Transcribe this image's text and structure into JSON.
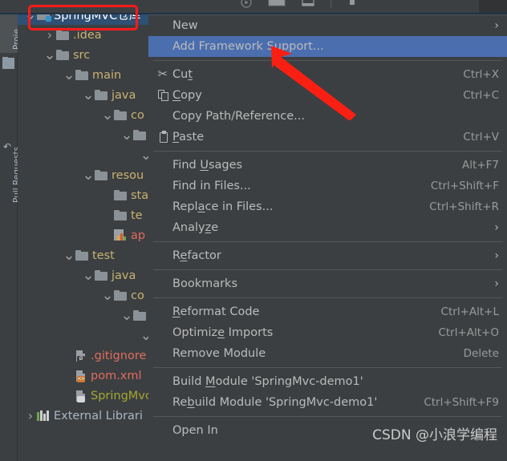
{
  "window": {
    "background": "#3c3f41",
    "accent_selection": "#4b6eaf",
    "tree_selection": "#2f4f73",
    "annotation_color": "#ff1a1a"
  },
  "toolstrip": {
    "project_label": "Proje",
    "pull_requests_label": "Pull Requests"
  },
  "tree": {
    "rows": [
      {
        "label": "SpringMVC仓库",
        "icon": "module-folder-icon",
        "twisty": "v",
        "depth": 0,
        "color": "sel",
        "selected": true
      },
      {
        "label": ".idea",
        "icon": "folder-icon",
        "twisty": ">",
        "depth": 1,
        "color": "dir",
        "selected": false
      },
      {
        "label": "src",
        "icon": "folder-icon",
        "twisty": "v",
        "depth": 1,
        "color": "dir",
        "selected": false
      },
      {
        "label": "main",
        "icon": "folder-icon",
        "twisty": "v",
        "depth": 2,
        "color": "dir",
        "selected": false
      },
      {
        "label": "java",
        "icon": "folder-icon",
        "twisty": "v",
        "depth": 3,
        "color": "dir",
        "selected": false
      },
      {
        "label": "co",
        "icon": "folder-icon",
        "twisty": "v",
        "depth": 4,
        "color": "dir",
        "selected": false
      },
      {
        "label": "",
        "icon": "folder-icon",
        "twisty": "v",
        "depth": 5,
        "color": "dir",
        "selected": false
      },
      {
        "label": "",
        "icon": "none",
        "twisty": "v",
        "depth": 6,
        "color": "dir",
        "selected": false
      },
      {
        "label": "resou",
        "icon": "folder-icon",
        "twisty": "v",
        "depth": 3,
        "color": "dir",
        "selected": false
      },
      {
        "label": "sta",
        "icon": "folder-icon",
        "twisty": "",
        "depth": 4,
        "color": "dir",
        "selected": false
      },
      {
        "label": "te",
        "icon": "folder-icon",
        "twisty": "",
        "depth": 4,
        "color": "dir",
        "selected": false
      },
      {
        "label": "ap",
        "icon": "properties-icon",
        "twisty": "",
        "depth": 4,
        "color": "red",
        "selected": false
      },
      {
        "label": "test",
        "icon": "folder-icon",
        "twisty": "v",
        "depth": 2,
        "color": "dir",
        "selected": false
      },
      {
        "label": "java",
        "icon": "folder-icon",
        "twisty": "v",
        "depth": 3,
        "color": "dir",
        "selected": false
      },
      {
        "label": "co",
        "icon": "folder-icon",
        "twisty": "v",
        "depth": 4,
        "color": "dir",
        "selected": false
      },
      {
        "label": "",
        "icon": "folder-icon",
        "twisty": "v",
        "depth": 5,
        "color": "dir",
        "selected": false
      },
      {
        "label": "",
        "icon": "none",
        "twisty": "v",
        "depth": 6,
        "color": "dir",
        "selected": false
      },
      {
        "label": ".gitignore",
        "icon": "gitignore-file-icon",
        "twisty": "",
        "depth": 2,
        "color": "red",
        "selected": false
      },
      {
        "label": "pom.xml",
        "icon": "xml-file-icon",
        "twisty": "",
        "depth": 2,
        "color": "red",
        "selected": false
      },
      {
        "label": "SpringMvc-",
        "icon": "iml-file-icon",
        "twisty": "",
        "depth": 2,
        "color": "olive",
        "selected": false
      },
      {
        "label": "External Librari",
        "icon": "library-icon",
        "twisty": ">",
        "depth": 0,
        "color": "gray",
        "selected": false
      }
    ]
  },
  "context_menu": {
    "items": [
      {
        "kind": "item",
        "label": "New",
        "accel": "",
        "icon": "",
        "arrow": true,
        "highlighted": false,
        "mnemonic": -1
      },
      {
        "kind": "item",
        "label": "Add Framework Support...",
        "accel": "",
        "icon": "",
        "arrow": false,
        "highlighted": true,
        "mnemonic": -1
      },
      {
        "kind": "separator"
      },
      {
        "kind": "item",
        "label": "Cut",
        "accel": "Ctrl+X",
        "icon": "cut-icon",
        "arrow": false,
        "highlighted": false,
        "mnemonic": 2
      },
      {
        "kind": "item",
        "label": "Copy",
        "accel": "Ctrl+C",
        "icon": "copy-icon",
        "arrow": false,
        "highlighted": false,
        "mnemonic": 0
      },
      {
        "kind": "item",
        "label": "Copy Path/Reference...",
        "accel": "",
        "icon": "",
        "arrow": false,
        "highlighted": false,
        "mnemonic": -1
      },
      {
        "kind": "item",
        "label": "Paste",
        "accel": "Ctrl+V",
        "icon": "paste-icon",
        "arrow": false,
        "highlighted": false,
        "mnemonic": 0
      },
      {
        "kind": "separator"
      },
      {
        "kind": "item",
        "label": "Find Usages",
        "accel": "Alt+F7",
        "icon": "",
        "arrow": false,
        "highlighted": false,
        "mnemonic": 5
      },
      {
        "kind": "item",
        "label": "Find in Files...",
        "accel": "Ctrl+Shift+F",
        "icon": "",
        "arrow": false,
        "highlighted": false,
        "mnemonic": -1
      },
      {
        "kind": "item",
        "label": "Replace in Files...",
        "accel": "Ctrl+Shift+R",
        "icon": "",
        "arrow": false,
        "highlighted": false,
        "mnemonic": 4
      },
      {
        "kind": "item",
        "label": "Analyze",
        "accel": "",
        "icon": "",
        "arrow": true,
        "highlighted": false,
        "mnemonic": 5
      },
      {
        "kind": "separator"
      },
      {
        "kind": "item",
        "label": "Refactor",
        "accel": "",
        "icon": "",
        "arrow": true,
        "highlighted": false,
        "mnemonic": 1
      },
      {
        "kind": "separator"
      },
      {
        "kind": "item",
        "label": "Bookmarks",
        "accel": "",
        "icon": "",
        "arrow": true,
        "highlighted": false,
        "mnemonic": -1
      },
      {
        "kind": "separator"
      },
      {
        "kind": "item",
        "label": "Reformat Code",
        "accel": "Ctrl+Alt+L",
        "icon": "",
        "arrow": false,
        "highlighted": false,
        "mnemonic": 0
      },
      {
        "kind": "item",
        "label": "Optimize Imports",
        "accel": "Ctrl+Alt+O",
        "icon": "",
        "arrow": false,
        "highlighted": false,
        "mnemonic": 7
      },
      {
        "kind": "item",
        "label": "Remove Module",
        "accel": "Delete",
        "icon": "",
        "arrow": false,
        "highlighted": false,
        "mnemonic": -1
      },
      {
        "kind": "separator"
      },
      {
        "kind": "item",
        "label": "Build Module 'SpringMvc-demo1'",
        "accel": "",
        "icon": "",
        "arrow": false,
        "highlighted": false,
        "mnemonic": 6
      },
      {
        "kind": "item",
        "label": "Rebuild Module 'SpringMvc-demo1'",
        "accel": "Ctrl+Shift+F9",
        "icon": "",
        "arrow": false,
        "highlighted": false,
        "mnemonic": 2
      },
      {
        "kind": "separator"
      },
      {
        "kind": "item",
        "label": "Open In",
        "accel": "",
        "icon": "",
        "arrow": false,
        "highlighted": false,
        "mnemonic": -1
      }
    ]
  },
  "annotations": {
    "highlight_box_target": "SpringMVC仓库",
    "arrow_target": "Add Framework Support..."
  },
  "watermark": {
    "text": "CSDN @小浪学编程"
  }
}
